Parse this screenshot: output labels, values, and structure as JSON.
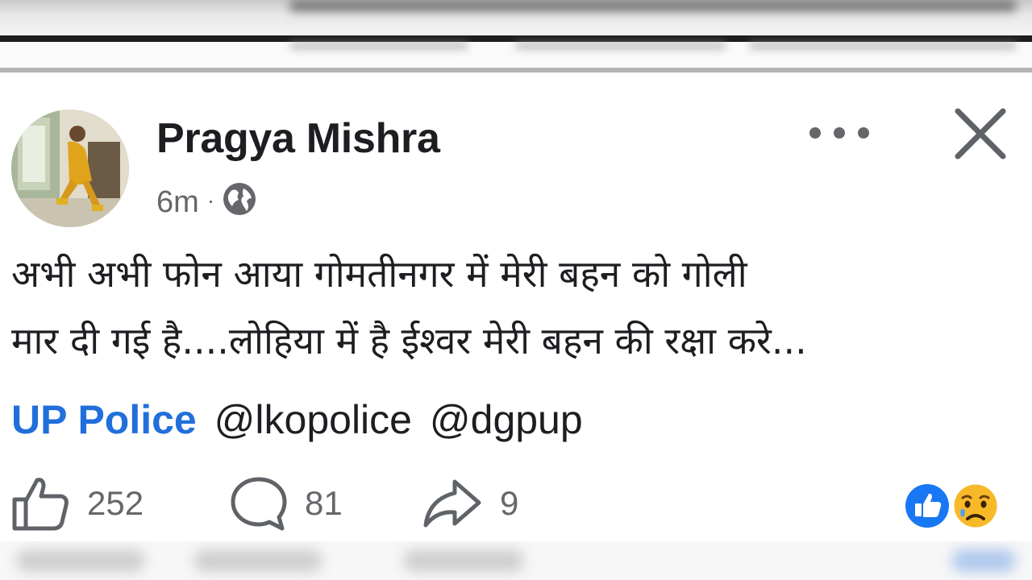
{
  "post": {
    "author": "Pragya Mishra",
    "timestamp": "6m",
    "separator": "·",
    "audience_icon": "globe-icon",
    "body_lines": [
      "अभी अभी फोन आया गोमतीनगर में मेरी बहन को गोली",
      "मार दी गई है....लोहिया में है ईश्वर मेरी बहन की रक्षा करे..."
    ],
    "tags": {
      "page": "UP Police",
      "mention_1": "@lkopolice",
      "mention_2": "@dgpup"
    }
  },
  "actions": {
    "like_count": "252",
    "comment_count": "81",
    "share_count": "9"
  },
  "reactions": [
    "like-reaction-icon",
    "sad-reaction-icon"
  ],
  "colors": {
    "link_blue": "#216fdb",
    "text": "#1c1e21",
    "muted": "#65676b",
    "like_blue": "#1877f2"
  }
}
